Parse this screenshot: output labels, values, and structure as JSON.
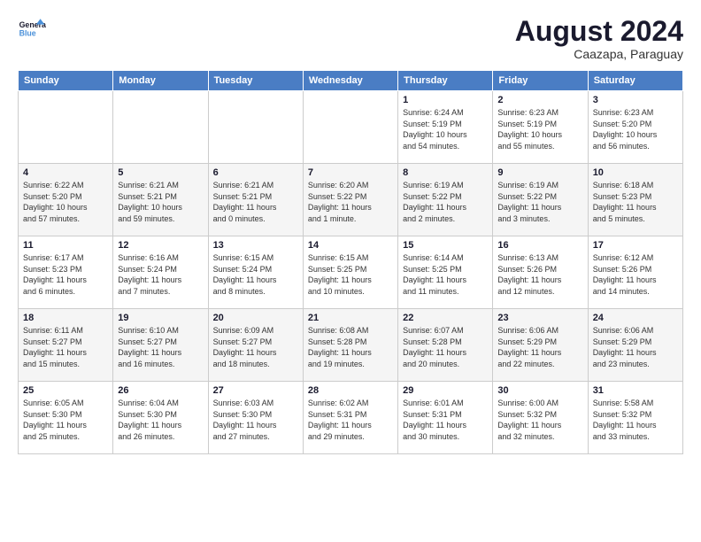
{
  "header": {
    "logo_line1": "General",
    "logo_line2": "Blue",
    "month_year": "August 2024",
    "location": "Caazapa, Paraguay"
  },
  "weekdays": [
    "Sunday",
    "Monday",
    "Tuesday",
    "Wednesday",
    "Thursday",
    "Friday",
    "Saturday"
  ],
  "weeks": [
    [
      {
        "day": "",
        "info": ""
      },
      {
        "day": "",
        "info": ""
      },
      {
        "day": "",
        "info": ""
      },
      {
        "day": "",
        "info": ""
      },
      {
        "day": "1",
        "info": "Sunrise: 6:24 AM\nSunset: 5:19 PM\nDaylight: 10 hours\nand 54 minutes."
      },
      {
        "day": "2",
        "info": "Sunrise: 6:23 AM\nSunset: 5:19 PM\nDaylight: 10 hours\nand 55 minutes."
      },
      {
        "day": "3",
        "info": "Sunrise: 6:23 AM\nSunset: 5:20 PM\nDaylight: 10 hours\nand 56 minutes."
      }
    ],
    [
      {
        "day": "4",
        "info": "Sunrise: 6:22 AM\nSunset: 5:20 PM\nDaylight: 10 hours\nand 57 minutes."
      },
      {
        "day": "5",
        "info": "Sunrise: 6:21 AM\nSunset: 5:21 PM\nDaylight: 10 hours\nand 59 minutes."
      },
      {
        "day": "6",
        "info": "Sunrise: 6:21 AM\nSunset: 5:21 PM\nDaylight: 11 hours\nand 0 minutes."
      },
      {
        "day": "7",
        "info": "Sunrise: 6:20 AM\nSunset: 5:22 PM\nDaylight: 11 hours\nand 1 minute."
      },
      {
        "day": "8",
        "info": "Sunrise: 6:19 AM\nSunset: 5:22 PM\nDaylight: 11 hours\nand 2 minutes."
      },
      {
        "day": "9",
        "info": "Sunrise: 6:19 AM\nSunset: 5:22 PM\nDaylight: 11 hours\nand 3 minutes."
      },
      {
        "day": "10",
        "info": "Sunrise: 6:18 AM\nSunset: 5:23 PM\nDaylight: 11 hours\nand 5 minutes."
      }
    ],
    [
      {
        "day": "11",
        "info": "Sunrise: 6:17 AM\nSunset: 5:23 PM\nDaylight: 11 hours\nand 6 minutes."
      },
      {
        "day": "12",
        "info": "Sunrise: 6:16 AM\nSunset: 5:24 PM\nDaylight: 11 hours\nand 7 minutes."
      },
      {
        "day": "13",
        "info": "Sunrise: 6:15 AM\nSunset: 5:24 PM\nDaylight: 11 hours\nand 8 minutes."
      },
      {
        "day": "14",
        "info": "Sunrise: 6:15 AM\nSunset: 5:25 PM\nDaylight: 11 hours\nand 10 minutes."
      },
      {
        "day": "15",
        "info": "Sunrise: 6:14 AM\nSunset: 5:25 PM\nDaylight: 11 hours\nand 11 minutes."
      },
      {
        "day": "16",
        "info": "Sunrise: 6:13 AM\nSunset: 5:26 PM\nDaylight: 11 hours\nand 12 minutes."
      },
      {
        "day": "17",
        "info": "Sunrise: 6:12 AM\nSunset: 5:26 PM\nDaylight: 11 hours\nand 14 minutes."
      }
    ],
    [
      {
        "day": "18",
        "info": "Sunrise: 6:11 AM\nSunset: 5:27 PM\nDaylight: 11 hours\nand 15 minutes."
      },
      {
        "day": "19",
        "info": "Sunrise: 6:10 AM\nSunset: 5:27 PM\nDaylight: 11 hours\nand 16 minutes."
      },
      {
        "day": "20",
        "info": "Sunrise: 6:09 AM\nSunset: 5:27 PM\nDaylight: 11 hours\nand 18 minutes."
      },
      {
        "day": "21",
        "info": "Sunrise: 6:08 AM\nSunset: 5:28 PM\nDaylight: 11 hours\nand 19 minutes."
      },
      {
        "day": "22",
        "info": "Sunrise: 6:07 AM\nSunset: 5:28 PM\nDaylight: 11 hours\nand 20 minutes."
      },
      {
        "day": "23",
        "info": "Sunrise: 6:06 AM\nSunset: 5:29 PM\nDaylight: 11 hours\nand 22 minutes."
      },
      {
        "day": "24",
        "info": "Sunrise: 6:06 AM\nSunset: 5:29 PM\nDaylight: 11 hours\nand 23 minutes."
      }
    ],
    [
      {
        "day": "25",
        "info": "Sunrise: 6:05 AM\nSunset: 5:30 PM\nDaylight: 11 hours\nand 25 minutes."
      },
      {
        "day": "26",
        "info": "Sunrise: 6:04 AM\nSunset: 5:30 PM\nDaylight: 11 hours\nand 26 minutes."
      },
      {
        "day": "27",
        "info": "Sunrise: 6:03 AM\nSunset: 5:30 PM\nDaylight: 11 hours\nand 27 minutes."
      },
      {
        "day": "28",
        "info": "Sunrise: 6:02 AM\nSunset: 5:31 PM\nDaylight: 11 hours\nand 29 minutes."
      },
      {
        "day": "29",
        "info": "Sunrise: 6:01 AM\nSunset: 5:31 PM\nDaylight: 11 hours\nand 30 minutes."
      },
      {
        "day": "30",
        "info": "Sunrise: 6:00 AM\nSunset: 5:32 PM\nDaylight: 11 hours\nand 32 minutes."
      },
      {
        "day": "31",
        "info": "Sunrise: 5:58 AM\nSunset: 5:32 PM\nDaylight: 11 hours\nand 33 minutes."
      }
    ]
  ]
}
